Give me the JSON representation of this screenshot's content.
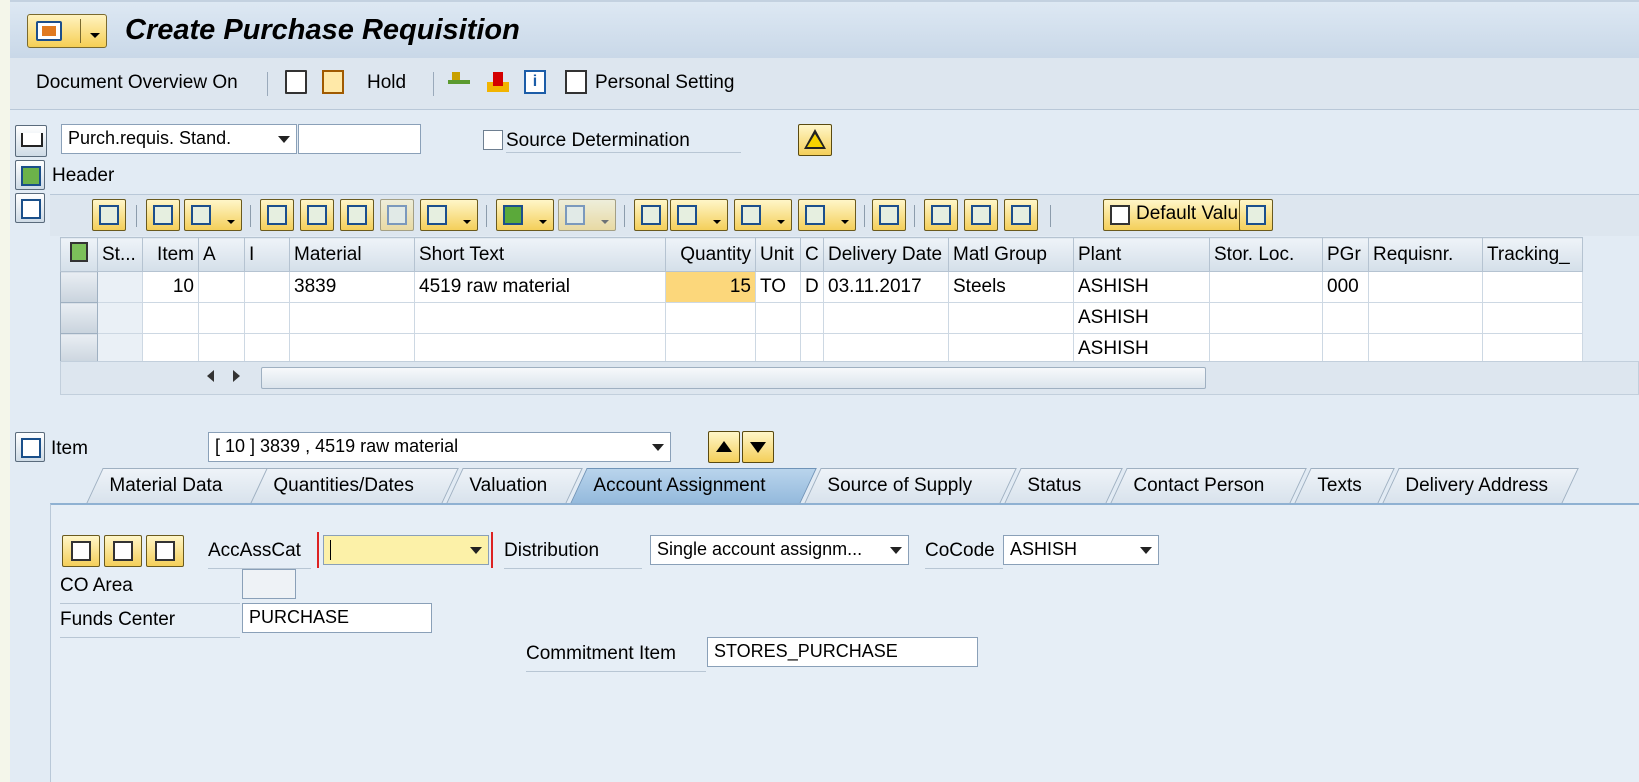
{
  "title": "Create Purchase Requisition",
  "app_toolbar": {
    "doc_overview": "Document Overview On",
    "hold": "Hold",
    "personal_setting": "Personal Setting"
  },
  "header_area": {
    "doc_type": "Purch.requis. Stand.",
    "doc_type_extra": "",
    "source_determination": "Source Determination",
    "header_label": "Header"
  },
  "grid_toolbar": {
    "default_values": "Default Values"
  },
  "grid": {
    "columns": [
      "St...",
      "Item",
      "A",
      "I",
      "Material",
      "Short Text",
      "Quantity",
      "Unit",
      "C",
      "Delivery Date",
      "Matl Group",
      "Plant",
      "Stor. Loc.",
      "PGr",
      "Requisnr.",
      "Tracking_"
    ],
    "rows": [
      [
        "",
        "10",
        "",
        "",
        "3839",
        "4519 raw material",
        "15",
        "TO",
        "D",
        "03.11.2017",
        "Steels",
        "ASHISH",
        "",
        "000",
        "",
        ""
      ],
      [
        "",
        "",
        "",
        "",
        "",
        "",
        "",
        "",
        "",
        "",
        "",
        "ASHISH",
        "",
        "",
        "",
        ""
      ],
      [
        "",
        "",
        "",
        "",
        "",
        "",
        "",
        "",
        "",
        "",
        "",
        "ASHISH",
        "",
        "",
        "",
        ""
      ]
    ]
  },
  "item_area": {
    "label": "Item",
    "selected_item": "[ 10 ] 3839 , 4519 raw material"
  },
  "tabs": [
    "Material Data",
    "Quantities/Dates",
    "Valuation",
    "Account Assignment",
    "Source of Supply",
    "Status",
    "Contact Person",
    "Texts",
    "Delivery Address"
  ],
  "active_tab": "Account Assignment",
  "account_assignment": {
    "acc_ass_cat_label": "AccAssCat",
    "acc_ass_cat_value": "",
    "distribution_label": "Distribution",
    "distribution_value": "Single account assignm...",
    "cocode_label": "CoCode",
    "cocode_value": "ASHISH",
    "co_area_label": "CO Area",
    "co_area_value": "",
    "funds_center_label": "Funds Center",
    "funds_center_value": "PURCHASE",
    "commitment_item_label": "Commitment Item",
    "commitment_item_value": "STORES_PURCHASE"
  },
  "colors": {
    "title_bg": "#c9d8e8",
    "quantity_highlight": "#fcd77b",
    "active_tab": "#93b9dc"
  }
}
